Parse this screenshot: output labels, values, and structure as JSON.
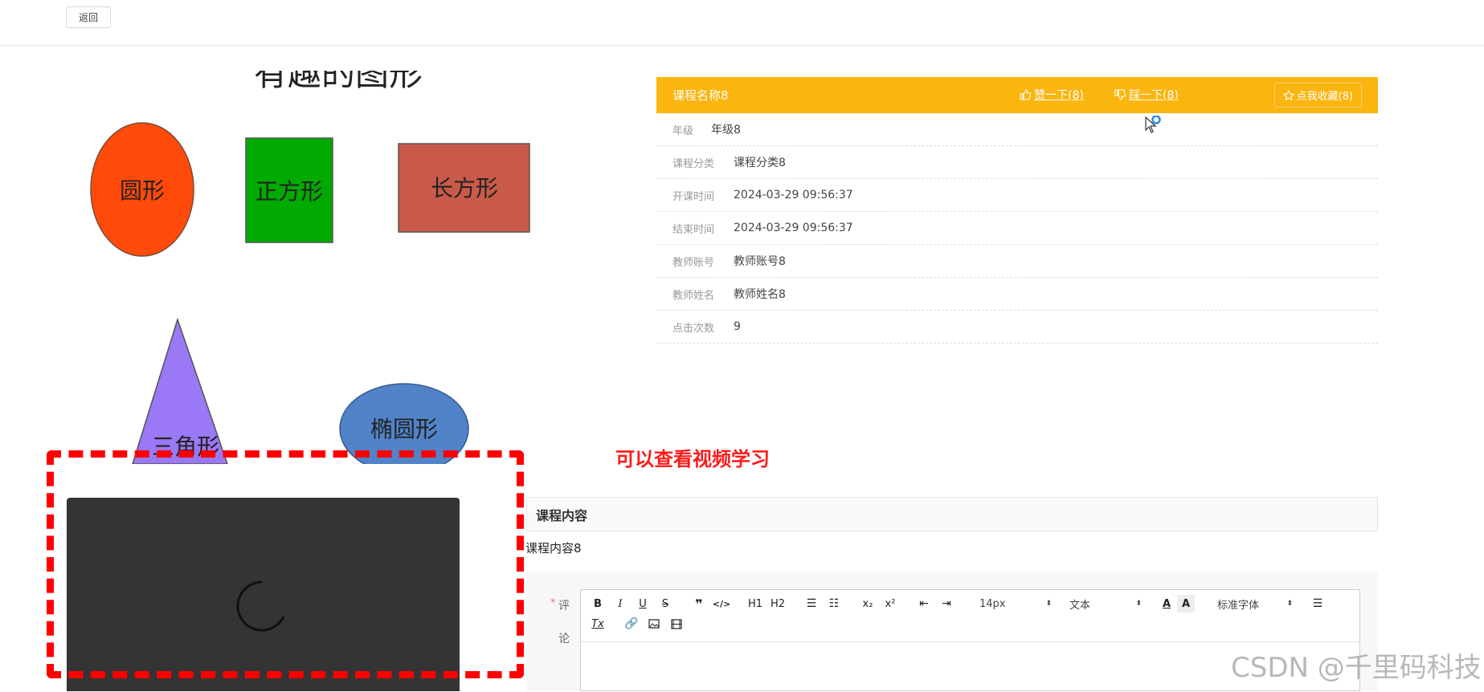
{
  "topbar": {
    "back_label": "返回"
  },
  "cover": {
    "title": "有趣的图形",
    "shapes": {
      "circle": "圆形",
      "square": "正方形",
      "rectangle": "长方形",
      "triangle": "三角形",
      "ellipse": "椭圆形"
    },
    "colors": {
      "circle": "#ff4a0a",
      "square": "#00aa00",
      "rectangle": "#c95a4a",
      "triangle": "#9a78f6",
      "ellipse": "#5083c8"
    }
  },
  "course": {
    "name": "课程名称8",
    "like_label": "赞一下(8)",
    "dislike_label": "踩一下(8)",
    "favorite_label": "点我收藏(8)",
    "header_color": "#fbb50f",
    "fields": [
      {
        "label": "年级",
        "value": "年级8"
      },
      {
        "label": "课程分类",
        "value": "课程分类8"
      },
      {
        "label": "开课时间",
        "value": "2024-03-29 09:56:37"
      },
      {
        "label": "结束时间",
        "value": "2024-03-29 09:56:37"
      },
      {
        "label": "教师账号",
        "value": "教师账号8"
      },
      {
        "label": "教师姓名",
        "value": "教师姓名8"
      },
      {
        "label": "点击次数",
        "value": "9"
      }
    ]
  },
  "annotation": {
    "text": "可以查看视频学习",
    "color": "#ff0000"
  },
  "content": {
    "section_title": "课程内容",
    "body": "课程内容8"
  },
  "comment": {
    "required_mark": "*",
    "label_line1": "评",
    "label_line2": "论",
    "toolbar": {
      "h1": "H1",
      "h2": "H2",
      "font_size": "14px",
      "text_type": "文本",
      "font_family": "标准字体"
    }
  },
  "watermark": "CSDN @千里码科技"
}
